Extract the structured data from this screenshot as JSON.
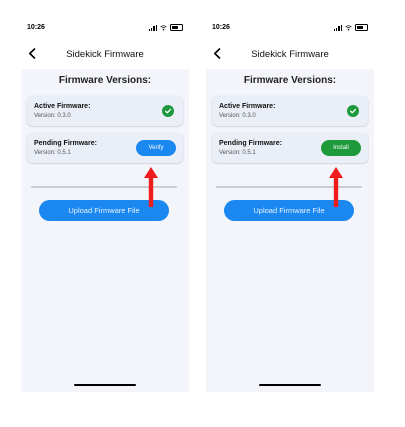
{
  "screens": [
    {
      "status_bar": {
        "time": "10:26"
      },
      "nav": {
        "title": "Sidekick Firmware"
      },
      "section_title": "Firmware Versions:",
      "active": {
        "label": "Active Firmware:",
        "version": "Version: 0.3.0"
      },
      "pending": {
        "label": "Pending Firmware:",
        "version": "Version: 0.5.1",
        "action_label": "Verify"
      },
      "upload_label": "Upload Firmware File"
    },
    {
      "status_bar": {
        "time": "10:26"
      },
      "nav": {
        "title": "Sidekick Firmware"
      },
      "section_title": "Firmware Versions:",
      "active": {
        "label": "Active Firmware:",
        "version": "Version: 0.3.0"
      },
      "pending": {
        "label": "Pending Firmware:",
        "version": "Version: 0.5.1",
        "action_label": "Install"
      },
      "upload_label": "Upload Firmware File"
    }
  ],
  "colors": {
    "primary_blue": "#1a88f0",
    "install_green": "#1f9a3a",
    "check_green": "#1e9a3e",
    "annotation_arrow": "#ee1c1c"
  }
}
